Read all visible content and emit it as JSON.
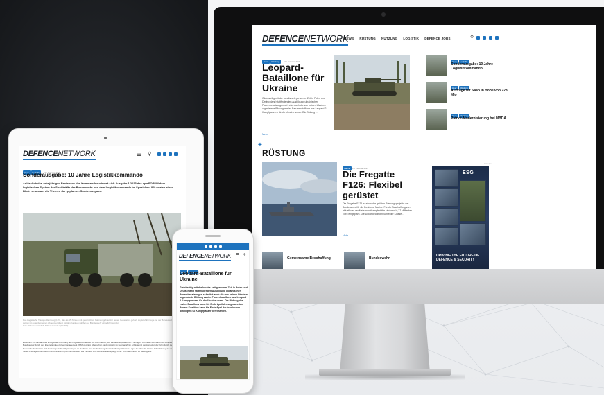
{
  "site": {
    "logo_bold": "DEFENCE",
    "logo_thin": "NETWORK",
    "accent_color": "#1e73be"
  },
  "desktop": {
    "nav": [
      "NEWS",
      "RÜSTUNG",
      "NUTZUNG",
      "LOGISTIK",
      "DEFENCE JOBS"
    ],
    "hero": {
      "tags": [
        "Heer",
        "Rüstung"
      ],
      "date": "20. Februar 2023",
      "title": "Leopard-Bataillone für Ukraine",
      "excerpt": "Gleichzeitig mit der bereits seit geraumer Zeit in Polen und Deutschland stattfindenden Ausbildung ukrainischer Panzerbesatzungen schreitet auch die von beiden Ländern organisierte Bildung zweier Panzerbataillone aus Leopard 2 Kampfpanzern für die Ukraine voran. Die Bildung …",
      "more": "Mehr"
    },
    "sidebar": [
      {
        "tags": [
          "Heer",
          "Logistik"
        ],
        "title": "Sonderausgabe: 10 Jahre Logistikkommando"
      },
      {
        "tags": [
          "Heer",
          "Rüstung"
        ],
        "title": "Aufträge für Saab in Höhe von 728 Mio"
      },
      {
        "tags": [
          "Heer",
          "Nutzung"
        ],
        "title": "Patriot-Modernisierung bei MBDA"
      }
    ],
    "section_title": "RÜSTUNG",
    "feature": {
      "tags": [
        "Marine"
      ],
      "date": "20. Februar 2023",
      "title": "Die Fregatte F126: Flexibel gerüstet",
      "excerpt": "Die Fregatte F126 ist eines der größten Rüstungsprojekte der Bundeswehr für die Deutsche Marine. Für die Beschaffung von aktuell vier der Mehrzweckkampfschiffe sind rund 6,27 Milliarden Euro eingeplant. Die Dokaf decomien Schiff der Klasse…",
      "more": "Mehr"
    },
    "ad": {
      "label": "Anzeige",
      "brand": "ESG",
      "slogan": "DRIVING THE FUTURE OF DEFENCE & SECURITY"
    },
    "bottom": [
      {
        "title": "Gemeinsame Beschaffung"
      },
      {
        "title": "Bundeswehr"
      }
    ]
  },
  "tablet": {
    "tags": [
      "Heer",
      "Logistik"
    ],
    "date": "20. Februar 2023",
    "title": "Sonderausgabe: 10 Jahre Logistikkommando",
    "lead": "Anlässlich des zehnjährigen Bestehens des Kommandos widmet sich Ausgabe 1/2023 des cpmFORUM dem logistischen System der Streitkräfte der Bundeswehr und dem Logistikkommando im Speziellen. Wir werfen einen Blick voraus auf die Themen der geplanten Sonderausgabe.",
    "caption": "Das Logistische Transportfahrzeug (LTF), das als 15-Tonnen mit geschütztem Kabinen gebaut zur neuen Generation gehört. Logistikfahrzeuge bei der Bundeswehr. Zu setzen ist außerdem einen Abnehmer direkt mit den Kabinen soll bei der Bundeswehr eingeführt werden.",
    "credit": "Foto: Rheinmetall MAN Military Vehicles (RMMV)",
    "body": "Exakt am 15. Januar 2013 erfolgte die Gründung des Logistikkommandos mit Sitz in Erfurt, der Landeshauptstadt von Thüringen. Zu dieser Zeit waren die Aufgaben der Bundeswehr durch den Internationalen Krisenmanagement (IKM) geprägt. Aber schon bald, nämlich im Februar 2014, erfolgte mit der Annexion der Krim durch die Russische Föderation und den kriegerischen Spannungen im Donbass eine Veränderung der Sicherheitspolitischen Lage, die über die letzten Jahre hinweg zu einem neuen Pflichtgebrauch und einer Orientierung der Bundeswehr auf Landes- und Bündnisverteidigung führte. Und damit auch für die Logistik."
  },
  "phone": {
    "tags": [
      "Heer",
      "Rüstung"
    ],
    "date": "20. Februar 2023",
    "title": "Leopard-Bataillone für Ukraine",
    "excerpt": "Gleichzeitig mit der bereits seit geraumer Zeit in Polen und Deutschland stattfindenden Ausbildung ukrainischer Panzerbesatzungen schreitet auch die von beiden Ländern organisierte Bildung zweier Panzerbataillone aus Leopard 2 Kampfpanzern für die Ukraine voran. Die Bildung des ersten Bataillons kann bis Ende April der sogenannten Panzer-Koalition kann bis Ende April der inzwischen beteiligten 62 Kampfpanzer bereitstellen."
  }
}
